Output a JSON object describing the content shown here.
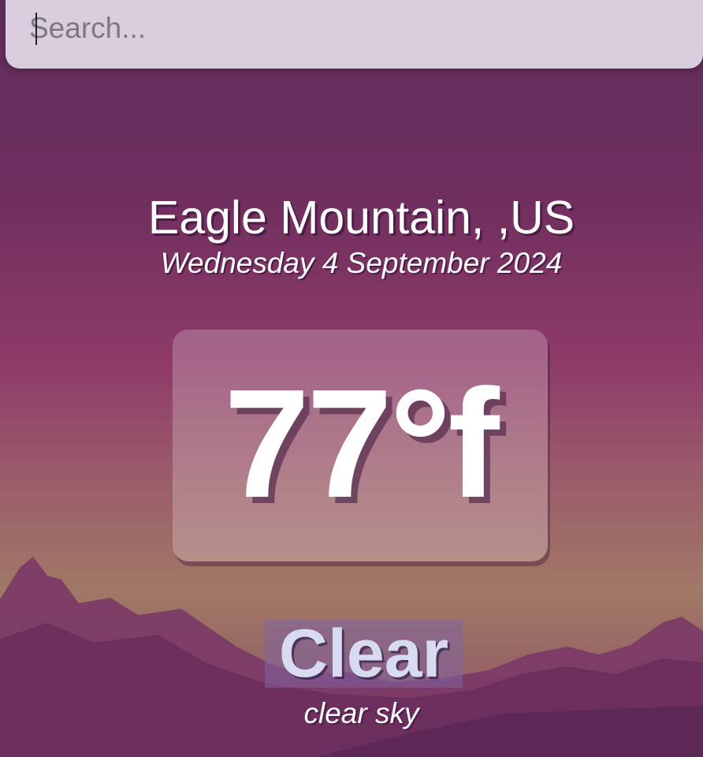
{
  "search": {
    "placeholder": "Search...",
    "value": ""
  },
  "weather": {
    "location": "Eagle Mountain, ,US",
    "date": "Wednesday 4 September 2024",
    "temperature": "77°f",
    "condition": "Clear",
    "description": "clear sky"
  },
  "colors": {
    "background_top": "#5f2d5b",
    "background_mid": "#8e3b68",
    "horizon": "#a17866",
    "search_bar": "#d9cddd",
    "condition_highlight": "#8064a0",
    "condition_text": "#d7daf0"
  },
  "decor": {
    "background_art": "mountains"
  }
}
